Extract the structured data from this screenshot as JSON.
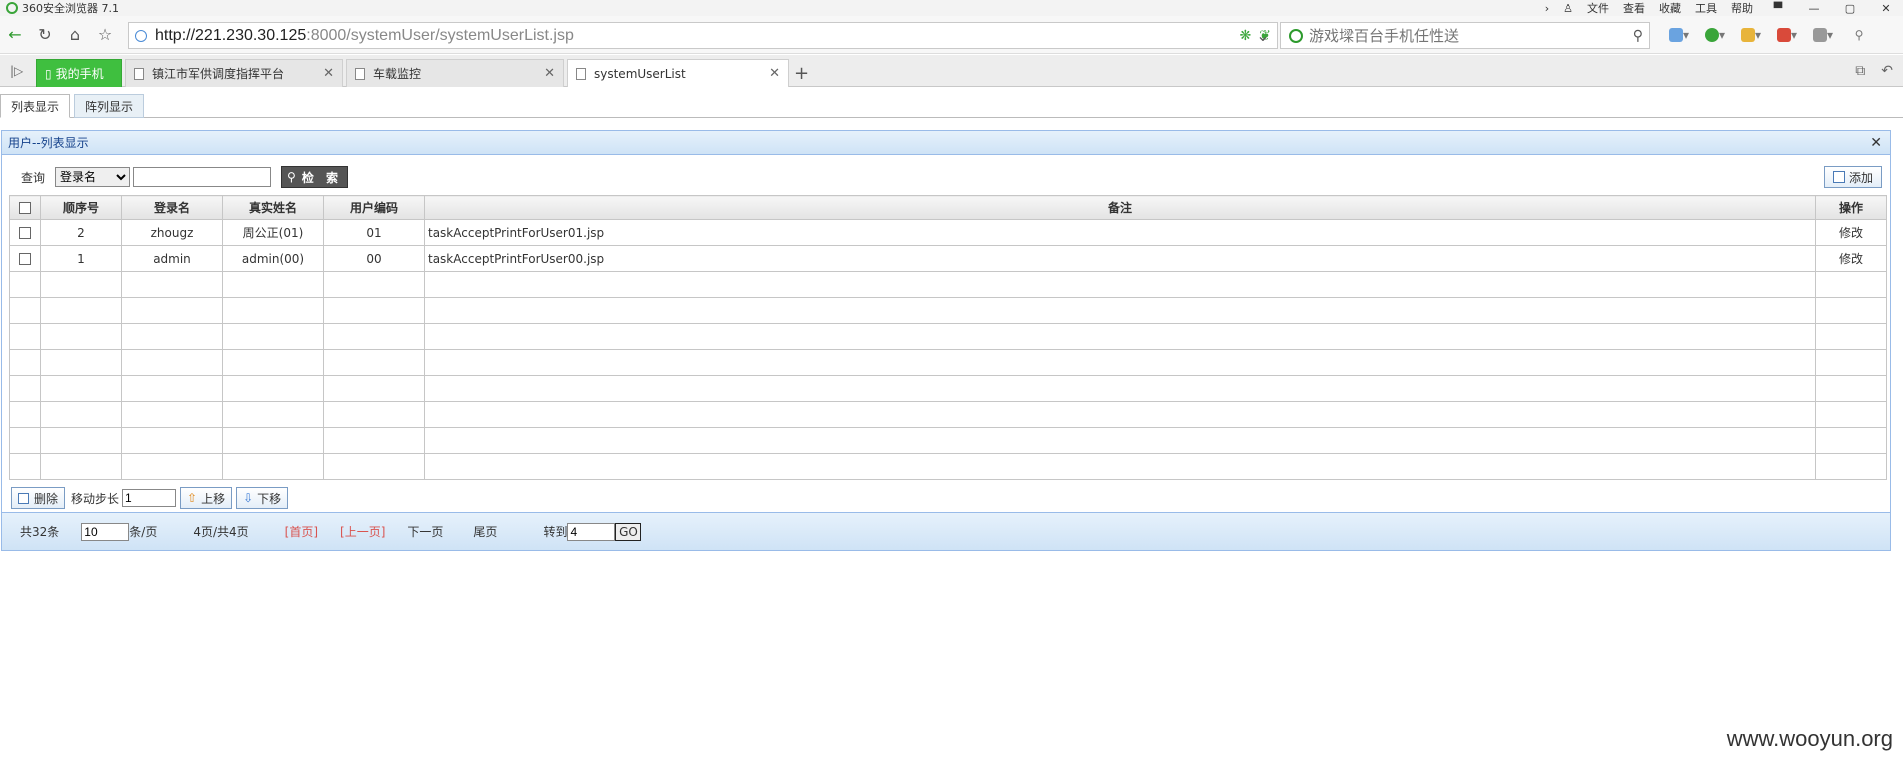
{
  "window": {
    "title": "360安全浏览器 7.1",
    "menu": [
      "文件",
      "查看",
      "收藏",
      "工具",
      "帮助"
    ]
  },
  "address": {
    "url_host": "http://221.230.30.125",
    "url_path": ":8000/systemUser/systemUserList.jsp",
    "search_placeholder": "游戏墚百台手机任性送"
  },
  "tabs": [
    {
      "label": "我的手机"
    },
    {
      "label": "镇江市军供调度指挥平台"
    },
    {
      "label": "车载监控"
    },
    {
      "label": "systemUserList"
    }
  ],
  "subtabs": {
    "list": "列表显示",
    "array": "阵列显示"
  },
  "panel": {
    "title": "用户--列表显示",
    "query_label": "查询",
    "query_field": "登录名",
    "search_button": "检 索",
    "add_button": "添加"
  },
  "table": {
    "headers": [
      "顺序号",
      "登录名",
      "真实姓名",
      "用户编码",
      "备注",
      "操作"
    ],
    "rows": [
      {
        "seq": "2",
        "login": "zhougz",
        "name": "周公正(01)",
        "code": "01",
        "note": "taskAcceptPrintForUser01.jsp",
        "action": "修改"
      },
      {
        "seq": "1",
        "login": "admin",
        "name": "admin(00)",
        "code": "00",
        "note": "taskAcceptPrintForUser00.jsp",
        "action": "修改"
      }
    ]
  },
  "actions": {
    "delete": "删除",
    "step_label": "移动步长",
    "step_value": "1",
    "up": "上移",
    "down": "下移"
  },
  "pager": {
    "total": "共32条",
    "page_size": "10",
    "per_page": "条/页",
    "page_info": "4页/共4页",
    "first": "[首页]",
    "prev": "[上一页]",
    "next": "下一页",
    "last": "尾页",
    "goto": "转到",
    "goto_value": "4",
    "go": "GO"
  },
  "watermark": "www.wooyun.org"
}
